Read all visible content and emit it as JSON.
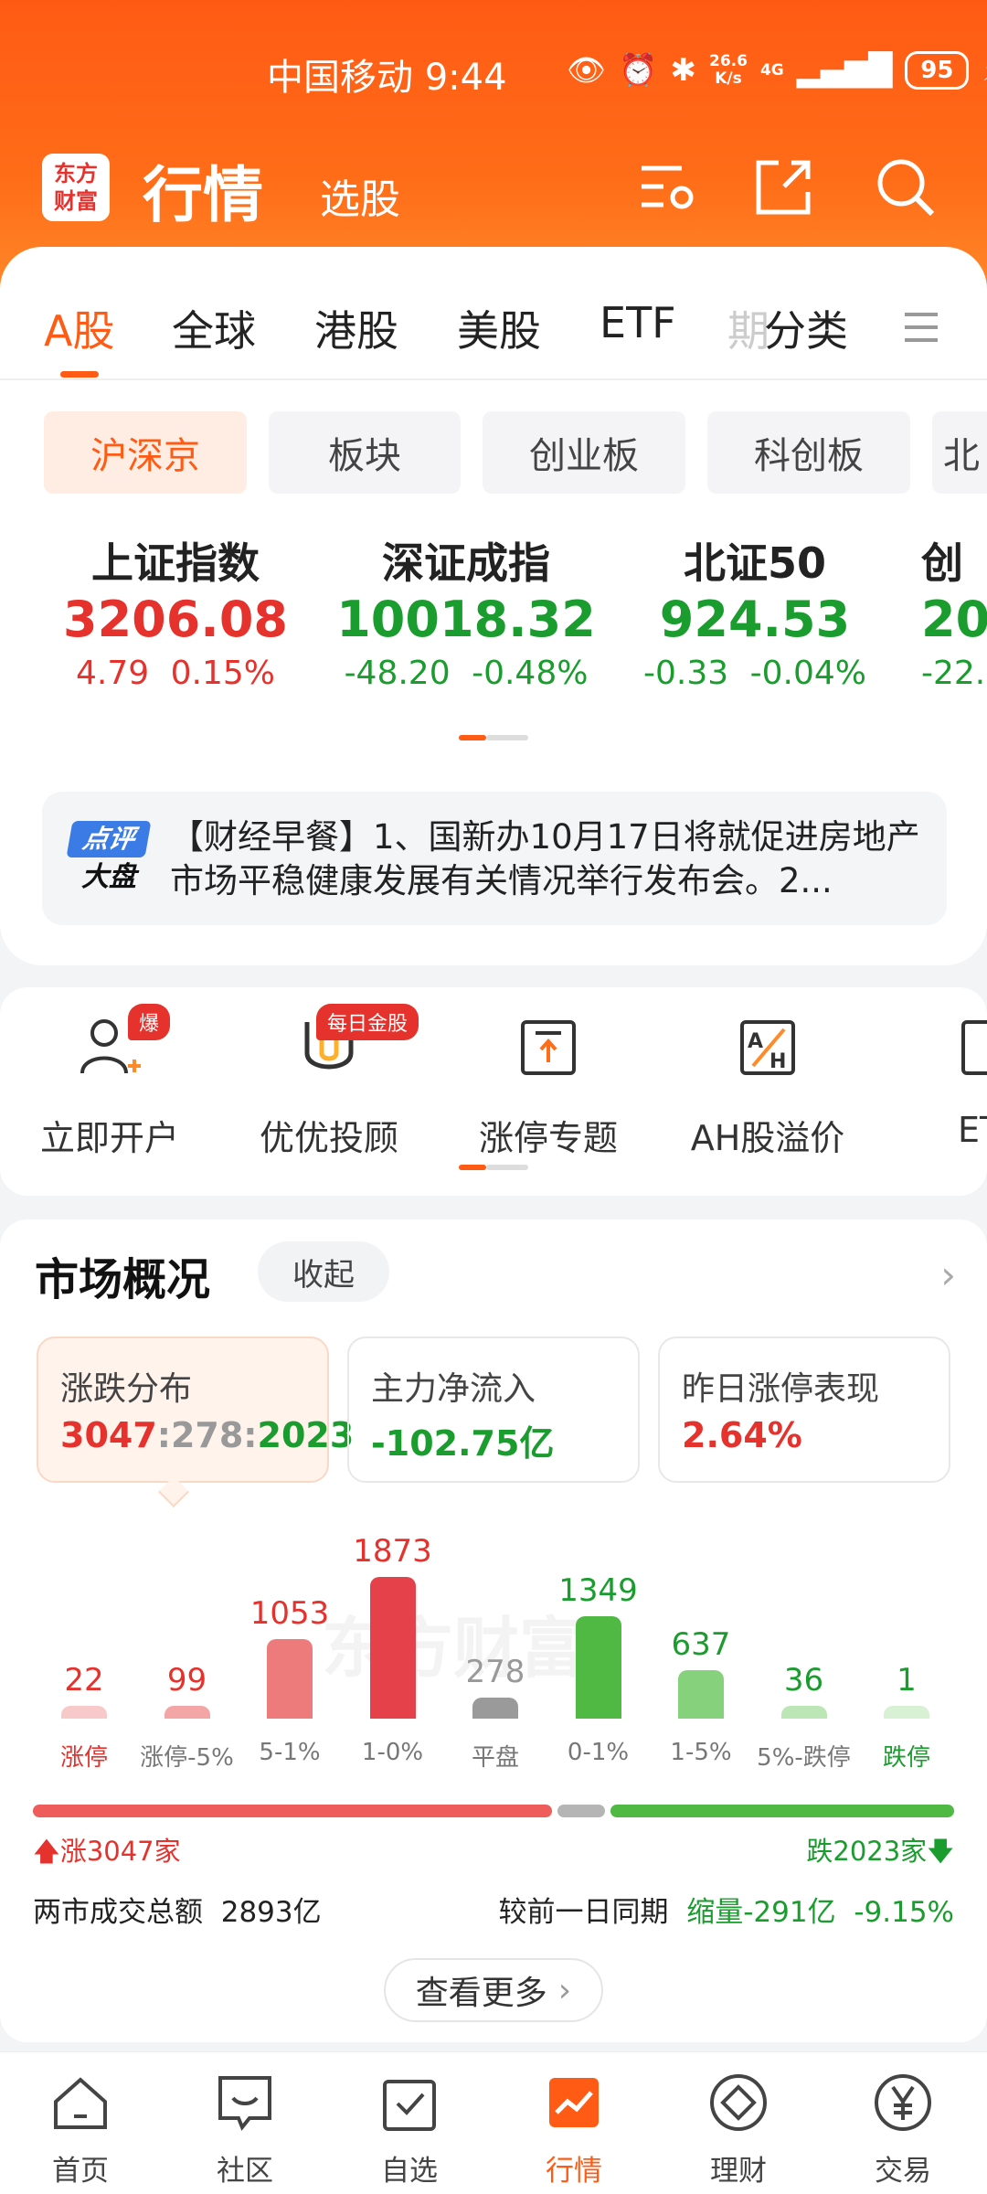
{
  "status": {
    "carrier_time": "中国移动 9:44",
    "speed_top": "26.6",
    "speed_bot": "K/s",
    "network": "4G",
    "battery": "95"
  },
  "header": {
    "logo_top": "东方",
    "logo_bottom": "财富",
    "title": "行情",
    "subtitle": "选股"
  },
  "tabs": [
    "A股",
    "全球",
    "港股",
    "美股",
    "ETF",
    "期",
    "分类"
  ],
  "pills": [
    "沪深京",
    "板块",
    "创业板",
    "科创板",
    "北"
  ],
  "indices": [
    {
      "name": "上证指数",
      "value": "3206.08",
      "change": "4.79",
      "pct": "0.15%"
    },
    {
      "name": "深证成指",
      "value": "10018.32",
      "change": "-48.20",
      "pct": "-0.48%"
    },
    {
      "name": "北证50",
      "value": "924.53",
      "change": "-0.33",
      "pct": "-0.04%"
    },
    {
      "name": "创",
      "value": "20",
      "change": "-22.",
      "pct": ""
    }
  ],
  "news": {
    "badge_top": "点评",
    "badge_bottom": "大盘",
    "text": "【财经早餐】1、国新办10月17日将就促进房地产市场平稳健康发展有关情况举行发布会。2..."
  },
  "shortcuts": [
    {
      "label": "立即开户",
      "badge": "爆"
    },
    {
      "label": "优优投顾",
      "badge": "每日金股"
    },
    {
      "label": "涨停专题",
      "badge": ""
    },
    {
      "label": "AH股溢价",
      "badge": ""
    },
    {
      "label": "ET",
      "badge": ""
    }
  ],
  "market": {
    "title": "市场概况",
    "collapse": "收起",
    "stats": [
      {
        "title": "涨跌分布",
        "up": "3047",
        "flat": "278",
        "down": "2023"
      },
      {
        "title": "主力净流入",
        "value": "-102.75亿"
      },
      {
        "title": "昨日涨停表现",
        "value": "2.64%"
      }
    ],
    "up_label": "涨3047家",
    "down_label": "跌2023家",
    "turnover_label": "两市成交总额",
    "turnover_value": "2893亿",
    "compare_label": "较前一日同期",
    "compare_value": "缩量-291亿",
    "compare_pct": "-9.15%",
    "more": "查看更多",
    "watermark": "东方财富"
  },
  "chart_data": {
    "type": "bar",
    "categories": [
      "涨停",
      "涨停-5%",
      "5-1%",
      "1-0%",
      "平盘",
      "0-1%",
      "1-5%",
      "5%-跌停",
      "跌停"
    ],
    "values": [
      22,
      99,
      1053,
      1873,
      278,
      1349,
      637,
      36,
      1
    ],
    "colors": [
      "#f8c9c9",
      "#f4a6a6",
      "#ee7b7b",
      "#e5414a",
      "#9a9a9a",
      "#4fb944",
      "#86d27c",
      "#bde6b6",
      "#d8f0d4"
    ],
    "value_colors": [
      "#e5322d",
      "#e5322d",
      "#e5322d",
      "#e5322d",
      "#999999",
      "#1b9c2e",
      "#1b9c2e",
      "#1b9c2e",
      "#1b9c2e"
    ]
  },
  "nav": [
    "首页",
    "社区",
    "自选",
    "行情",
    "理财",
    "交易"
  ]
}
